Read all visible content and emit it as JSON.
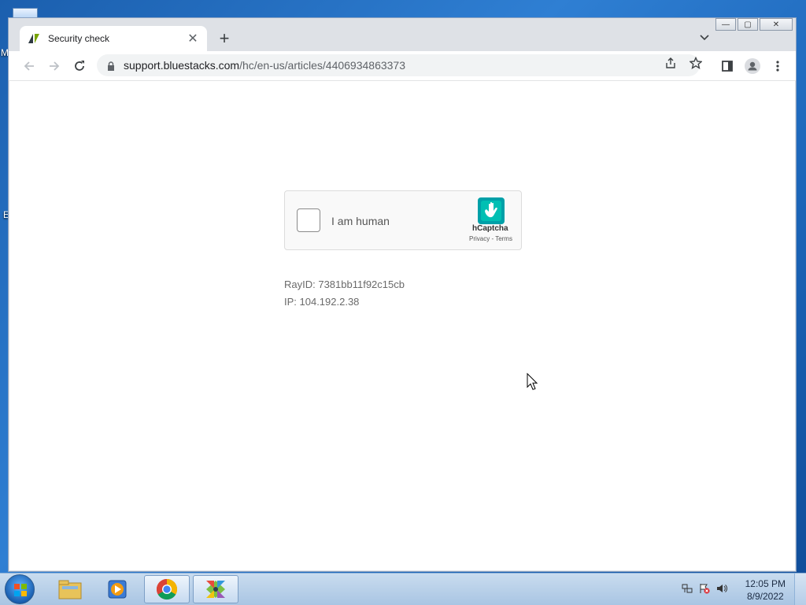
{
  "desktop": {
    "letters": [
      "M",
      "E"
    ]
  },
  "window": {
    "controls": {
      "minimize": "—",
      "maximize": "▢",
      "close": "✕"
    }
  },
  "tab": {
    "title": "Security check",
    "close": "✕",
    "new_tab": "+"
  },
  "toolbar": {
    "url_host": "support.bluestacks.com",
    "url_path": "/hc/en-us/articles/4406934863373"
  },
  "captcha": {
    "label": "I am human",
    "brand": "hCaptcha",
    "links": "Privacy - Terms"
  },
  "info": {
    "ray_id": "RayID: 7381bb11f92c15cb",
    "ip": "IP: 104.192.2.38"
  },
  "taskbar": {
    "time": "12:05 PM",
    "date": "8/9/2022"
  },
  "icons": {
    "tab_favicon": "zendesk-icon",
    "back": "arrow-left-icon",
    "forward": "arrow-right-icon",
    "reload": "reload-icon",
    "lock": "lock-icon",
    "share": "share-icon",
    "bookmark": "star-icon",
    "side_panel": "side-panel-icon",
    "profile": "profile-icon",
    "menu": "kebab-menu-icon"
  },
  "colors": {
    "hcaptcha_teal": "#00a0a8",
    "window_frame": "#dee1e6",
    "desktop_blue": "#2f7fd3"
  }
}
